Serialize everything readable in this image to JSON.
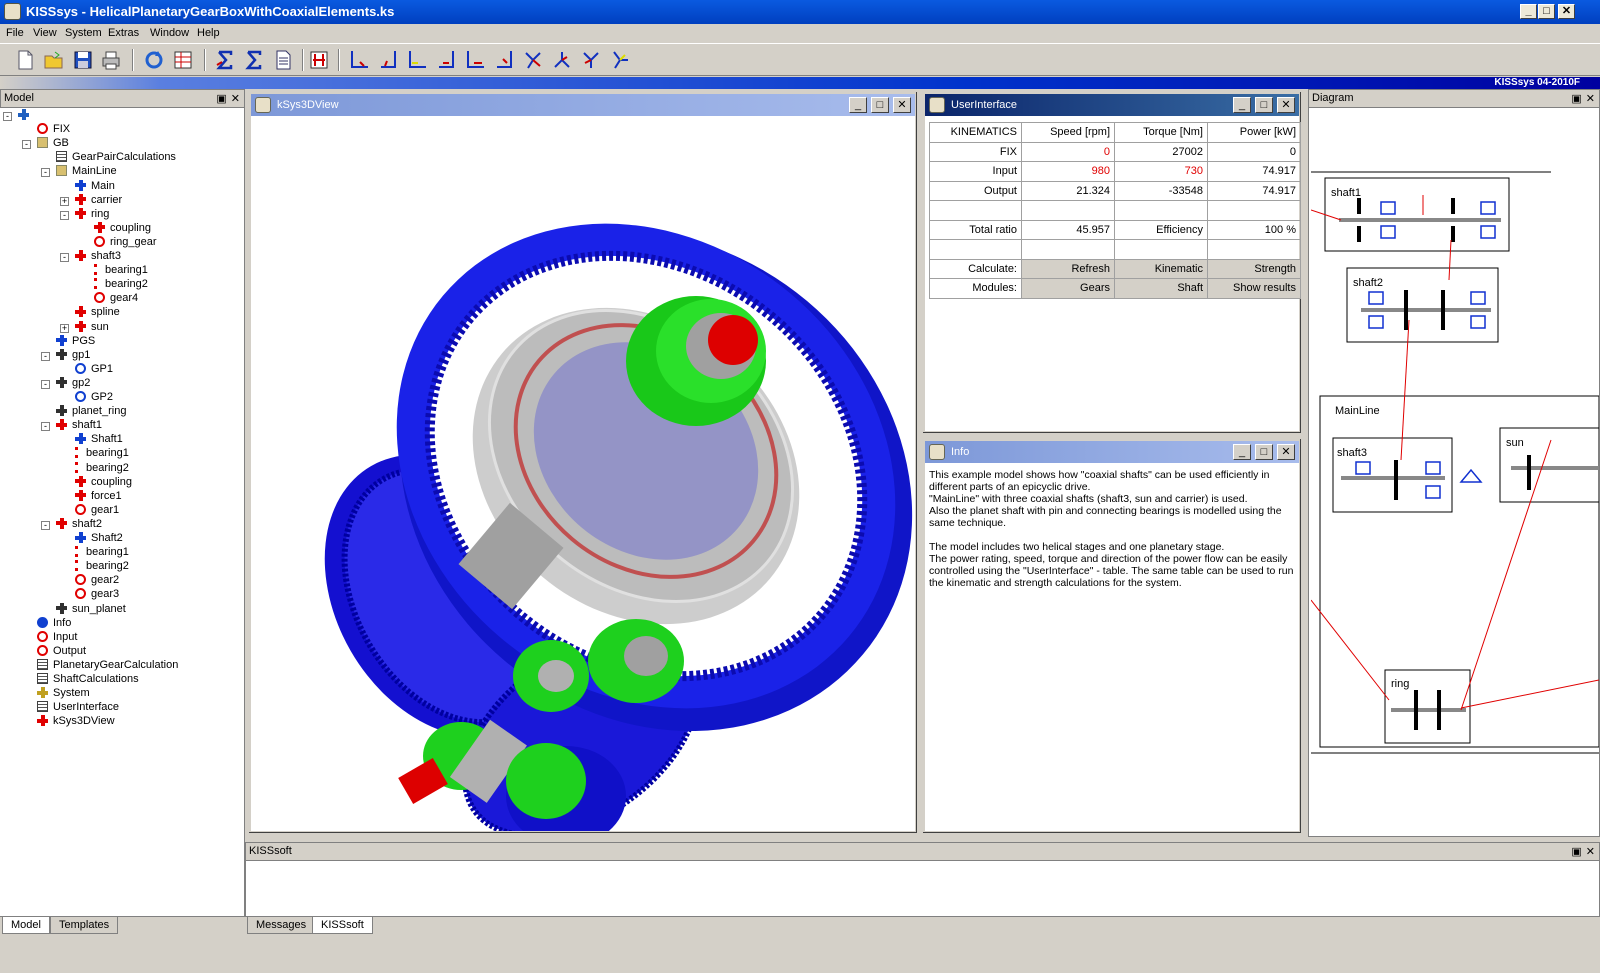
{
  "window": {
    "title": "KISSsys - HelicalPlanetaryGearBoxWithCoaxialElements.ks",
    "controls": [
      "_",
      "□",
      "✕"
    ]
  },
  "menu": [
    "File",
    "View",
    "System",
    "Extras",
    "Window",
    "Help"
  ],
  "version": "KISSsys 04-2010F",
  "model_panel": {
    "title": "Model",
    "tree": [
      {
        "label": "",
        "level": 0,
        "icon": "root-icon",
        "toggle": "-"
      },
      {
        "label": "FIX",
        "level": 1,
        "icon": "connection-icon"
      },
      {
        "label": "GB",
        "level": 1,
        "icon": "folder-icon",
        "toggle": "-"
      },
      {
        "label": "GearPairCalculations",
        "level": 2,
        "icon": "table-icon"
      },
      {
        "label": "MainLine",
        "level": 2,
        "icon": "folder-icon",
        "toggle": "-"
      },
      {
        "label": "Main",
        "level": 3,
        "icon": "shaft-blue-icon"
      },
      {
        "label": "carrier",
        "level": 3,
        "icon": "shaft-red-icon",
        "toggle": "+"
      },
      {
        "label": "ring",
        "level": 3,
        "icon": "shaft-red-icon",
        "toggle": "-"
      },
      {
        "label": "coupling",
        "level": 4,
        "icon": "coupling-icon"
      },
      {
        "label": "ring_gear",
        "level": 4,
        "icon": "gear-icon"
      },
      {
        "label": "shaft3",
        "level": 3,
        "icon": "shaft-red-icon",
        "toggle": "-"
      },
      {
        "label": "bearing1",
        "level": 4,
        "icon": "bearing-icon"
      },
      {
        "label": "bearing2",
        "level": 4,
        "icon": "bearing-icon"
      },
      {
        "label": "gear4",
        "level": 4,
        "icon": "gear-icon"
      },
      {
        "label": "spline",
        "level": 3,
        "icon": "spline-icon"
      },
      {
        "label": "sun",
        "level": 3,
        "icon": "shaft-red-icon",
        "toggle": "+"
      },
      {
        "label": "PGS",
        "level": 2,
        "icon": "pgs-icon"
      },
      {
        "label": "gp1",
        "level": 2,
        "icon": "link-icon",
        "toggle": "-"
      },
      {
        "label": "GP1",
        "level": 3,
        "icon": "gearpair-icon"
      },
      {
        "label": "gp2",
        "level": 2,
        "icon": "link-icon",
        "toggle": "-"
      },
      {
        "label": "GP2",
        "level": 3,
        "icon": "gearpair-icon"
      },
      {
        "label": "planet_ring",
        "level": 2,
        "icon": "link-icon"
      },
      {
        "label": "shaft1",
        "level": 2,
        "icon": "shaft-red-icon",
        "toggle": "-"
      },
      {
        "label": "Shaft1",
        "level": 3,
        "icon": "shaft-blue-icon"
      },
      {
        "label": "bearing1",
        "level": 3,
        "icon": "bearing-icon"
      },
      {
        "label": "bearing2",
        "level": 3,
        "icon": "bearing-icon"
      },
      {
        "label": "coupling",
        "level": 3,
        "icon": "coupling-icon"
      },
      {
        "label": "force1",
        "level": 3,
        "icon": "force-icon"
      },
      {
        "label": "gear1",
        "level": 3,
        "icon": "gear-icon"
      },
      {
        "label": "shaft2",
        "level": 2,
        "icon": "shaft-red-icon",
        "toggle": "-"
      },
      {
        "label": "Shaft2",
        "level": 3,
        "icon": "shaft-blue-icon"
      },
      {
        "label": "bearing1",
        "level": 3,
        "icon": "bearing-icon"
      },
      {
        "label": "bearing2",
        "level": 3,
        "icon": "bearing-icon"
      },
      {
        "label": "gear2",
        "level": 3,
        "icon": "gear-icon"
      },
      {
        "label": "gear3",
        "level": 3,
        "icon": "gear-icon"
      },
      {
        "label": "sun_planet",
        "level": 2,
        "icon": "link-icon"
      },
      {
        "label": "Info",
        "level": 1,
        "icon": "info-icon"
      },
      {
        "label": "Input",
        "level": 1,
        "icon": "connection-icon"
      },
      {
        "label": "Output",
        "level": 1,
        "icon": "connection-icon"
      },
      {
        "label": "PlanetaryGearCalculation",
        "level": 1,
        "icon": "table-icon"
      },
      {
        "label": "ShaftCalculations",
        "level": 1,
        "icon": "table-icon"
      },
      {
        "label": "System",
        "level": 1,
        "icon": "system-icon"
      },
      {
        "label": "UserInterface",
        "level": 1,
        "icon": "table-icon"
      },
      {
        "label": "kSys3DView",
        "level": 1,
        "icon": "view3d-icon"
      }
    ],
    "tabs": [
      "Model",
      "Templates"
    ]
  },
  "view3d": {
    "title": "kSys3DView"
  },
  "user_interface": {
    "title": "UserInterface",
    "headers": [
      "KINEMATICS",
      "Speed [rpm]",
      "Torque [Nm]",
      "Power [kW]"
    ],
    "rows": [
      {
        "label": "FIX",
        "speed": "0",
        "torque": "27002",
        "power": "0"
      },
      {
        "label": "Input",
        "speed": "980",
        "torque": "730",
        "power": "74.917"
      },
      {
        "label": "Output",
        "speed": "21.324",
        "torque": "-33548",
        "power": "74.917"
      }
    ],
    "total_ratio_label": "Total ratio",
    "total_ratio": "45.957",
    "efficiency_label": "Efficiency",
    "efficiency": "100 %",
    "calculate_label": "Calculate:",
    "calculate_buttons": [
      "Refresh",
      "Kinematic",
      "Strength"
    ],
    "modules_label": "Modules:",
    "modules_buttons": [
      "Gears",
      "Shaft",
      "Show results"
    ]
  },
  "info": {
    "title": "Info",
    "paragraph1": "This example model shows how \"coaxial shafts\" can be used efficiently in different parts of an epicyclic drive.\n\"MainLine\" with three coaxial shafts (shaft3, sun and carrier) is used.\nAlso the planet shaft with pin and connecting bearings is modelled using the same technique.",
    "paragraph2": "The model includes two helical stages and one planetary stage.\nThe power rating, speed, torque and direction of the power flow can be easily controlled using the \"UserInterface\" - table. The same table can be used to run the kinematic and strength calculations for the system."
  },
  "diagram": {
    "title": "Diagram",
    "labels": [
      "shaft1",
      "shaft2",
      "MainLine",
      "shaft3",
      "sun",
      "ring"
    ]
  },
  "kisssoft_panel": {
    "title": "KISSsoft",
    "tabs": [
      "Messages",
      "KISSsoft"
    ]
  },
  "colors": {
    "accent_blue": "#0033cc",
    "gear_blue": "#1a1ee0",
    "bearing_green": "#1ecc1e",
    "shaft_red": "#e00000"
  }
}
